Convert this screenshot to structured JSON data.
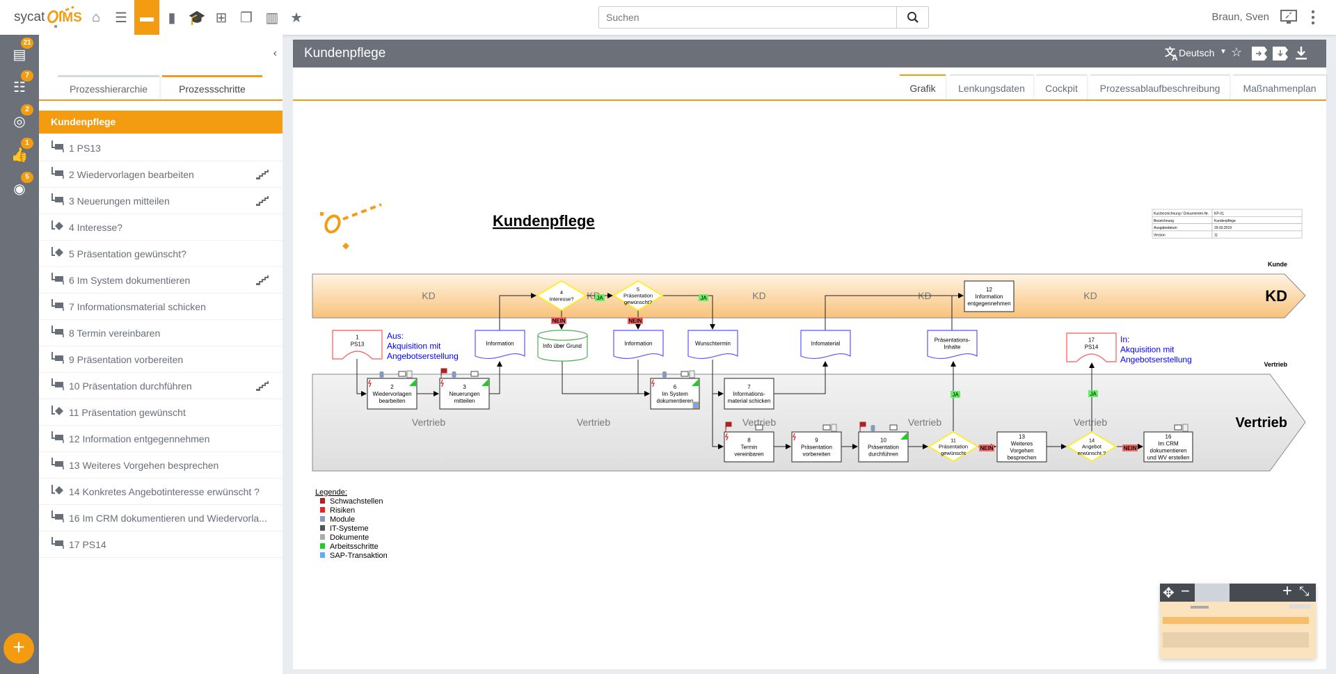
{
  "topbar": {
    "logo_text": "sycat",
    "logo_ims": "IMS",
    "nav_icons": [
      "home-icon",
      "tasks-icon",
      "process-icon",
      "document-icon",
      "training-icon",
      "org-chart-icon",
      "copies-icon",
      "chart-icon",
      "star-icon"
    ],
    "active_nav": "process-icon",
    "search_placeholder": "Suchen",
    "user": "Braun, Sven",
    "accent": "#f39c12"
  },
  "rail": {
    "items": [
      {
        "icon": "document-gear-icon",
        "badge": "21"
      },
      {
        "icon": "checklist-icon",
        "badge": "7"
      },
      {
        "icon": "glasses-icon",
        "badge": "2"
      },
      {
        "icon": "thumbs-icon",
        "badge": "1"
      },
      {
        "icon": "target-check-icon",
        "badge": "5"
      }
    ],
    "add_label": "+"
  },
  "sidepanel": {
    "tabs": [
      {
        "label": "Prozesshierarchie",
        "active": false
      },
      {
        "label": "Prozessschritte",
        "active": true
      }
    ],
    "selected": "Kundenpflege",
    "items": [
      {
        "label": "1 PS13",
        "icon": "process-step-icon",
        "stairs": false
      },
      {
        "label": "2 Wiedervorlagen bearbeiten",
        "icon": "process-step-icon",
        "stairs": true
      },
      {
        "label": "3 Neuerungen mitteilen",
        "icon": "process-step-icon",
        "stairs": true
      },
      {
        "label": "4 Interesse?",
        "icon": "decision-icon",
        "stairs": false
      },
      {
        "label": "5 Präsentation gewünscht?",
        "icon": "decision-icon",
        "stairs": false
      },
      {
        "label": "6 Im System dokumentieren",
        "icon": "process-step-icon",
        "stairs": true
      },
      {
        "label": "7 Informationsmaterial schicken",
        "icon": "process-step-icon",
        "stairs": false
      },
      {
        "label": "8 Termin vereinbaren",
        "icon": "process-step-icon",
        "stairs": false
      },
      {
        "label": "9 Präsentation vorbereiten",
        "icon": "process-step-icon",
        "stairs": false
      },
      {
        "label": "10 Präsentation durchführen",
        "icon": "process-step-icon",
        "stairs": true
      },
      {
        "label": "11 Präsentation gewünscht",
        "icon": "decision-icon",
        "stairs": false
      },
      {
        "label": "12 Information entgegennehmen",
        "icon": "process-step-icon",
        "stairs": false
      },
      {
        "label": "13 Weiteres Vorgehen besprechen",
        "icon": "process-step-icon",
        "stairs": false
      },
      {
        "label": "14 Konkretes Angebotinteresse erwünscht ?",
        "icon": "decision-icon",
        "stairs": false
      },
      {
        "label": "16 Im CRM dokumentieren und Wiedervorla...",
        "icon": "process-step-icon",
        "stairs": false
      },
      {
        "label": "17 PS14",
        "icon": "process-step-icon",
        "stairs": false
      }
    ]
  },
  "main": {
    "title": "Kundenpflege",
    "language": "Deutsch",
    "header_icons": [
      "translate-icon",
      "caret-down-icon",
      "star-icon",
      "import-process-icon",
      "export-process-icon",
      "download-icon"
    ],
    "tabs": [
      {
        "label": "Grafik",
        "active": true
      },
      {
        "label": "Lenkungsdaten"
      },
      {
        "label": "Cockpit"
      },
      {
        "label": "Prozessablaufbeschreibung"
      },
      {
        "label": "Maßnahmenplan"
      }
    ]
  },
  "diagram": {
    "title": "Kundenpflege",
    "info_table": [
      [
        "Kurzbezeichnung / Dokumenten-Nr.",
        "KP-01"
      ],
      [
        "Bezeichnung",
        "Kundenpflege"
      ],
      [
        "Ausgabedatum",
        "29.03.2019"
      ],
      [
        "Version",
        "11"
      ]
    ],
    "lanes": [
      {
        "name": "KD",
        "caption": "Kunde",
        "label": "KD"
      },
      {
        "name": "Vertrieb",
        "caption": "Vertrieb",
        "label": "Vertrieb"
      }
    ],
    "nodes": {
      "n1": {
        "lines": [
          "1",
          "PS13"
        ]
      },
      "n2": {
        "lines": [
          "2",
          "Wiedervorlagen",
          "bearbeiten"
        ]
      },
      "n3": {
        "lines": [
          "3",
          "Neuerungen",
          "mitteilen"
        ]
      },
      "n4": {
        "lines": [
          "4",
          "Interesse?"
        ]
      },
      "n5": {
        "lines": [
          "5",
          "Präsentation",
          "gewünscht?"
        ]
      },
      "n6": {
        "lines": [
          "6",
          "Im System",
          "dokumentieren"
        ]
      },
      "n7": {
        "lines": [
          "7",
          "Informations-",
          "material schicken"
        ]
      },
      "n8": {
        "lines": [
          "8",
          "Termin",
          "vereinbaren"
        ]
      },
      "n9": {
        "lines": [
          "9",
          "Präsentation",
          "vorbereiten"
        ]
      },
      "n10": {
        "lines": [
          "10",
          "Präsentation",
          "durchführen"
        ]
      },
      "n11": {
        "lines": [
          "11",
          "Präsentation",
          "gewünscht"
        ]
      },
      "n12": {
        "lines": [
          "12",
          "Information",
          "entgegennehmen"
        ]
      },
      "n13": {
        "lines": [
          "13",
          "Weiteres",
          "Vorgehen",
          "besprechen"
        ]
      },
      "n14": {
        "lines": [
          "14",
          "Angebot",
          "erwünscht ?"
        ]
      },
      "n16": {
        "lines": [
          "16",
          "Im CRM",
          "dokumentieren",
          "und WV erstellen"
        ]
      },
      "n17": {
        "lines": [
          "17",
          "PS14"
        ]
      },
      "d_info1": {
        "lines": [
          "Information"
        ]
      },
      "d_grund": {
        "lines": [
          "Info über Grund"
        ]
      },
      "d_info2": {
        "lines": [
          "Information"
        ]
      },
      "d_wunsch": {
        "lines": [
          "Wunschtermin"
        ]
      },
      "d_infomat": {
        "lines": [
          "Infomaterial"
        ]
      },
      "d_praes": {
        "lines": [
          "Präsentations-",
          "Inhalte"
        ]
      }
    },
    "interface_out": {
      "lines": [
        "Aus:",
        "Akquisition mit",
        "Angebotserstellung"
      ]
    },
    "interface_in": {
      "lines": [
        "In:",
        "Akquisition mit",
        "Angebotserstellung"
      ]
    },
    "edge_labels": {
      "yes": "JA",
      "no": "NEIN"
    },
    "legend": {
      "title": "Legende:",
      "items": [
        {
          "label": "Schwachstellen",
          "icon": "flag-icon"
        },
        {
          "label": "Risiken",
          "icon": "lightning-icon"
        },
        {
          "label": "Module",
          "icon": "database-icon"
        },
        {
          "label": "IT-Systeme",
          "icon": "monitor-icon"
        },
        {
          "label": "Dokumente",
          "icon": "document-icon"
        },
        {
          "label": "Arbeitsschritte",
          "icon": "green-triangle-icon"
        },
        {
          "label": "SAP-Transaktion",
          "icon": "sap-icon"
        }
      ]
    },
    "colors": {
      "kd_lane": "#fcd9a4",
      "vertrieb_lane": "#e6e6e6",
      "document": "#5555ff",
      "interface": "#ff5555",
      "database": "#55aa55",
      "decision": "#ffee00",
      "yes": "#66ee66",
      "no": "#ff6666",
      "interface_text": "#0000ff"
    }
  },
  "minimap": {
    "icons": [
      "move-icon",
      "zoom-out-icon",
      "zoom-in-icon",
      "fit-icon"
    ]
  }
}
